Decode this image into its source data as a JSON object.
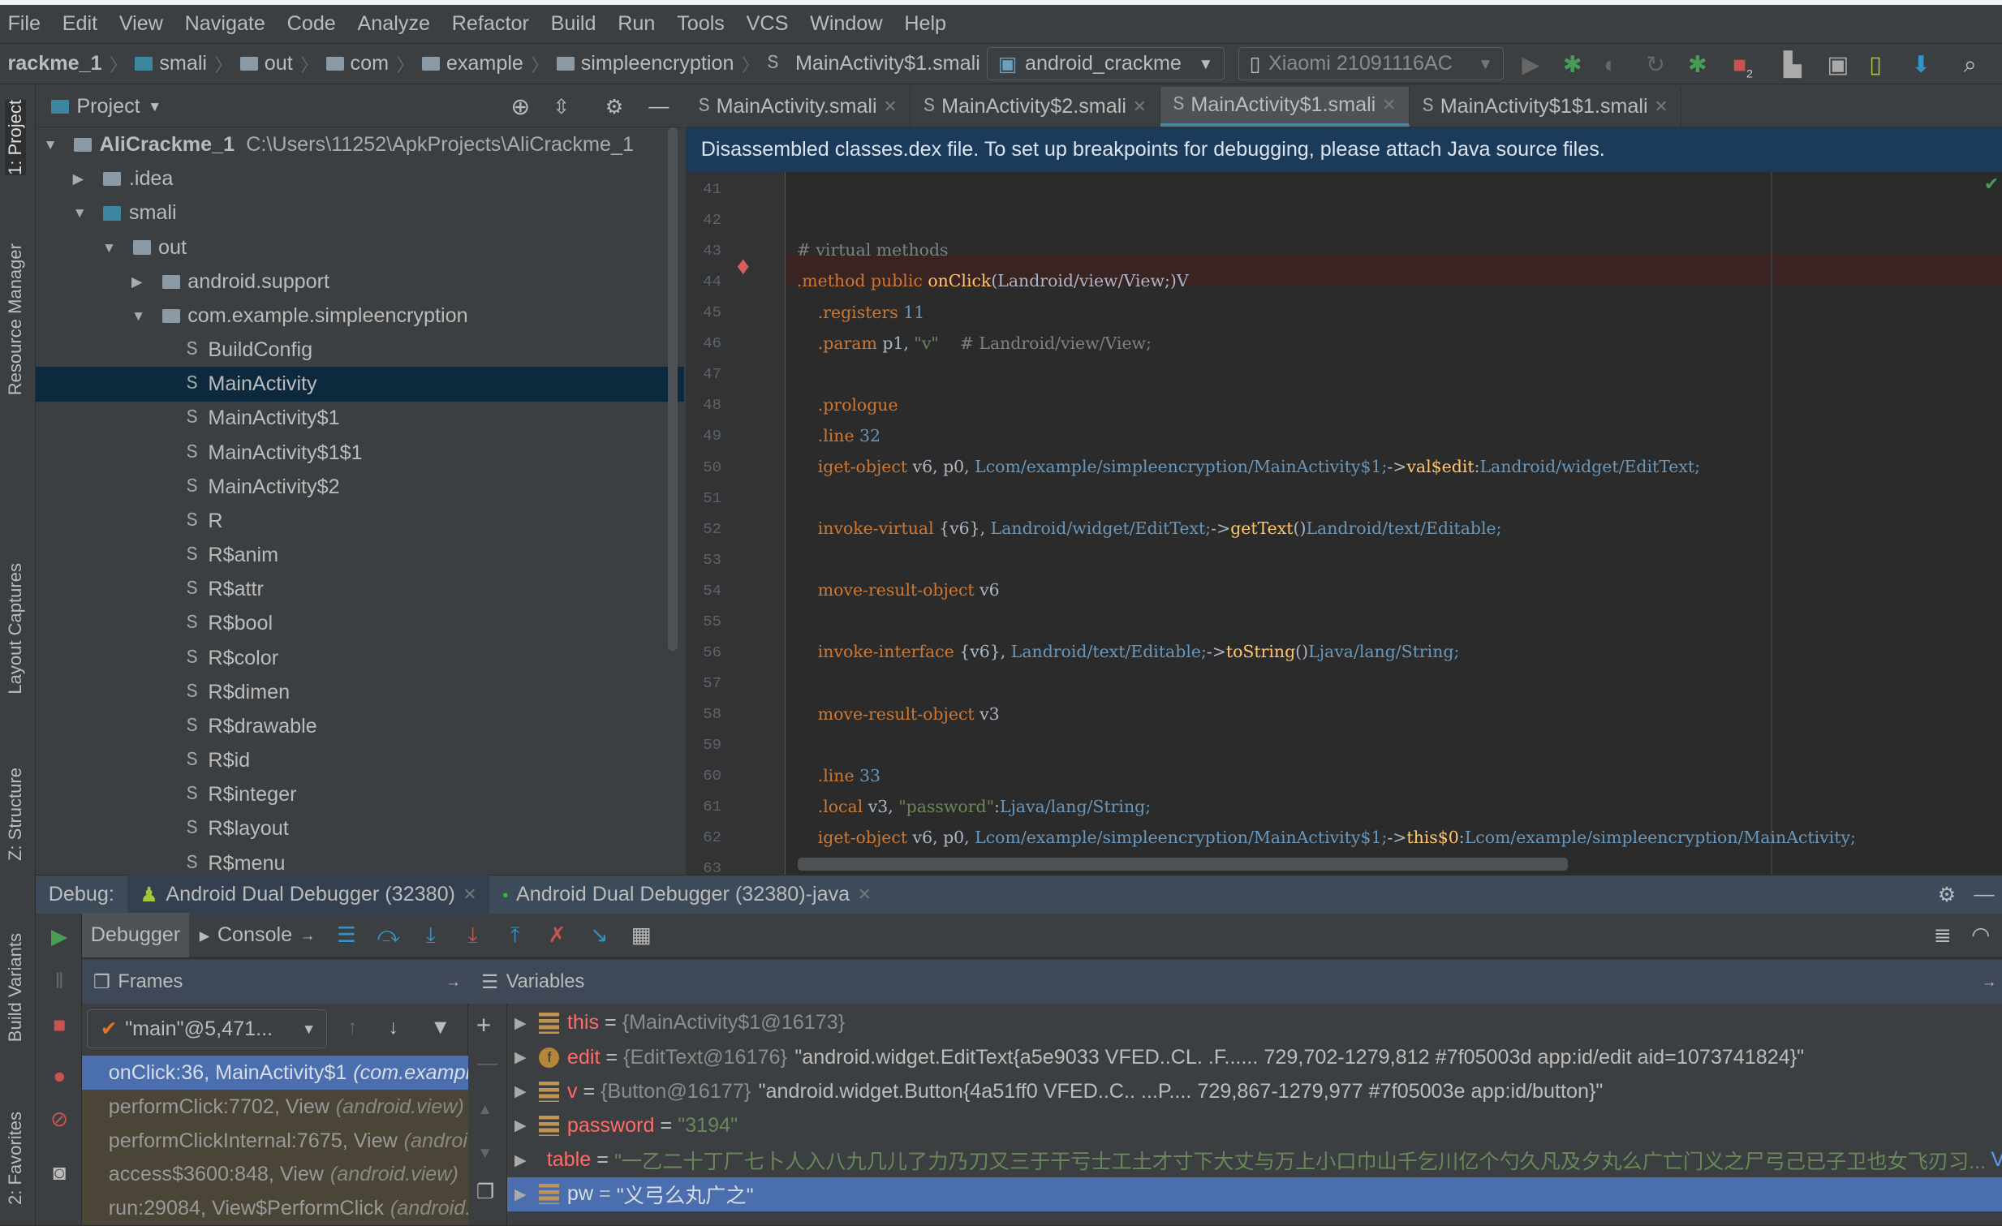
{
  "menu": [
    "File",
    "Edit",
    "View",
    "Navigate",
    "Code",
    "Analyze",
    "Refactor",
    "Build",
    "Run",
    "Tools",
    "VCS",
    "Window",
    "Help"
  ],
  "breadcrumb": [
    "rackme_1",
    "smali",
    "out",
    "com",
    "example",
    "simpleencryption",
    "MainActivity$1.smali"
  ],
  "toolbar": {
    "run_config": "android_crackme",
    "device": "Xiaomi 21091116AC",
    "stop_badge": "2"
  },
  "left_strip": [
    "1: Project",
    "Resource Manager",
    "Layout Captures",
    "Z: Structure",
    "Build Variants",
    "2: Favorites"
  ],
  "project": {
    "title": "Project",
    "tree": [
      {
        "label": "AliCrackme_1",
        "path": "C:\\Users\\11252\\ApkProjects\\AliCrackme_1",
        "depth": 0,
        "expanded": true,
        "kind": "module"
      },
      {
        "label": ".idea",
        "depth": 1,
        "expanded": false,
        "kind": "folder"
      },
      {
        "label": "smali",
        "depth": 1,
        "expanded": true,
        "kind": "folder"
      },
      {
        "label": "out",
        "depth": 2,
        "expanded": true,
        "kind": "folder"
      },
      {
        "label": "android.support",
        "depth": 3,
        "expanded": false,
        "kind": "folder"
      },
      {
        "label": "com.example.simpleencryption",
        "depth": 3,
        "expanded": true,
        "kind": "folder"
      },
      {
        "label": "BuildConfig",
        "depth": 4,
        "kind": "smali"
      },
      {
        "label": "MainActivity",
        "depth": 4,
        "kind": "smali",
        "selected": true
      },
      {
        "label": "MainActivity$1",
        "depth": 4,
        "kind": "smali"
      },
      {
        "label": "MainActivity$1$1",
        "depth": 4,
        "kind": "smali"
      },
      {
        "label": "MainActivity$2",
        "depth": 4,
        "kind": "smali"
      },
      {
        "label": "R",
        "depth": 4,
        "kind": "smali"
      },
      {
        "label": "R$anim",
        "depth": 4,
        "kind": "smali"
      },
      {
        "label": "R$attr",
        "depth": 4,
        "kind": "smali"
      },
      {
        "label": "R$bool",
        "depth": 4,
        "kind": "smali"
      },
      {
        "label": "R$color",
        "depth": 4,
        "kind": "smali"
      },
      {
        "label": "R$dimen",
        "depth": 4,
        "kind": "smali"
      },
      {
        "label": "R$drawable",
        "depth": 4,
        "kind": "smali"
      },
      {
        "label": "R$id",
        "depth": 4,
        "kind": "smali"
      },
      {
        "label": "R$integer",
        "depth": 4,
        "kind": "smali"
      },
      {
        "label": "R$layout",
        "depth": 4,
        "kind": "smali"
      },
      {
        "label": "R$menu",
        "depth": 4,
        "kind": "smali"
      }
    ]
  },
  "editor": {
    "tabs": [
      {
        "label": "MainActivity.smali"
      },
      {
        "label": "MainActivity$2.smali"
      },
      {
        "label": "MainActivity$1.smali",
        "active": true
      },
      {
        "label": "MainActivity$1$1.smali"
      }
    ],
    "banner": "Disassembled classes.dex file. To set up breakpoints for debugging, please attach Java source files.",
    "first_line": 41,
    "breakpoint_line": 44,
    "lines": [
      [],
      [],
      [
        [
          "c",
          "# virtual methods"
        ]
      ],
      [
        [
          "k",
          ".method public "
        ],
        [
          "f",
          "onClick"
        ],
        [
          "",
          "(Landroid/view/View;)V"
        ]
      ],
      [
        [
          "k",
          "    .registers "
        ],
        [
          "t",
          "11"
        ]
      ],
      [
        [
          "k",
          "    .param "
        ],
        [
          "",
          "p1, "
        ],
        [
          "s",
          "\"v\""
        ],
        [
          "c",
          "    # Landroid/view/View;"
        ]
      ],
      [],
      [
        [
          "k",
          "    .prologue"
        ]
      ],
      [
        [
          "k",
          "    .line "
        ],
        [
          "t",
          "32"
        ]
      ],
      [
        [
          "k",
          "    iget-object "
        ],
        [
          "",
          "v6, p0, "
        ],
        [
          "t",
          "Lcom/example/simpleencryption/MainActivity$1;"
        ],
        [
          "",
          "->"
        ],
        [
          "f",
          "val$edit"
        ],
        [
          "",
          ":"
        ],
        [
          "t",
          "Landroid/widget/EditText;"
        ]
      ],
      [],
      [
        [
          "k",
          "    invoke-virtual "
        ],
        [
          "",
          "{v6}, "
        ],
        [
          "t",
          "Landroid/widget/EditText;"
        ],
        [
          "",
          "->"
        ],
        [
          "f",
          "getText"
        ],
        [
          "",
          "()"
        ],
        [
          "t",
          "Landroid/text/Editable;"
        ]
      ],
      [],
      [
        [
          "k",
          "    move-result-object "
        ],
        [
          "",
          "v6"
        ]
      ],
      [],
      [
        [
          "k",
          "    invoke-interface "
        ],
        [
          "",
          "{v6}, "
        ],
        [
          "t",
          "Landroid/text/Editable;"
        ],
        [
          "",
          "->"
        ],
        [
          "f",
          "toString"
        ],
        [
          "",
          "()"
        ],
        [
          "t",
          "Ljava/lang/String;"
        ]
      ],
      [],
      [
        [
          "k",
          "    move-result-object "
        ],
        [
          "",
          "v3"
        ]
      ],
      [],
      [
        [
          "k",
          "    .line "
        ],
        [
          "t",
          "33"
        ]
      ],
      [
        [
          "k",
          "    .local "
        ],
        [
          "",
          "v3, "
        ],
        [
          "s",
          "\"password\""
        ],
        [
          "",
          ":"
        ],
        [
          "t",
          "Ljava/lang/String;"
        ]
      ],
      [
        [
          "k",
          "    iget-object "
        ],
        [
          "",
          "v6, p0, "
        ],
        [
          "t",
          "Lcom/example/simpleencryption/MainActivity$1;"
        ],
        [
          "",
          "->"
        ],
        [
          "f",
          "this$0"
        ],
        [
          "",
          ":"
        ],
        [
          "t",
          "Lcom/example/simpleencryption/MainActivity;"
        ]
      ],
      []
    ]
  },
  "debug": {
    "label": "Debug:",
    "sessions": [
      {
        "label": "Android Dual Debugger (32380)",
        "active": true
      },
      {
        "label": "Android Dual Debugger (32380)-java"
      }
    ],
    "tabs": {
      "debugger": "Debugger",
      "console": "Console"
    },
    "frames_title": "Frames",
    "variables_title": "Variables",
    "thread": "\"main\"@5,471...",
    "frames": [
      {
        "method": "onClick:36, MainActivity$1",
        "pkg": "(com.example.simpleencryption)",
        "selected": true
      },
      {
        "method": "performClick:7702, View",
        "pkg": "(android.view)"
      },
      {
        "method": "performClickInternal:7675, View",
        "pkg": "(android.view)"
      },
      {
        "method": "access$3600:848, View",
        "pkg": "(android.view)"
      },
      {
        "method": "run:29084, View$PerformClick",
        "pkg": "(android.view)"
      }
    ],
    "variables": [
      {
        "name": "this",
        "type": "{MainActivity$1@16173}",
        "value": "",
        "icon": "field"
      },
      {
        "name": "edit",
        "type": "{EditText@16176}",
        "value": "\"android.widget.EditText{a5e9033 VFED..CL. .F...... 729,702-1279,812 #7f05003d app:id/edit aid=1073741824}\"",
        "icon": "final-field"
      },
      {
        "name": "v",
        "type": "{Button@16177}",
        "value": "\"android.widget.Button{4a51ff0 VFED..C.. ...P.... 729,867-1279,977 #7f05003e app:id/button}\"",
        "icon": "field"
      },
      {
        "name": "password",
        "type": "",
        "str": "\"3194\"",
        "icon": "field"
      },
      {
        "name": "table",
        "type": "",
        "str": "\"一乙二十丁厂七卜人入八九几儿了力乃刀又三于干亏士工土才寸下大丈与万上小口巾山千乞川亿个勺久凡及夕丸么广亡门义之尸弓己已子卫也女飞刃习...",
        "link": "View",
        "icon": "field"
      },
      {
        "name": "pw",
        "type": "",
        "str": "\"义弓么丸广之\"",
        "icon": "field",
        "selected": true
      }
    ]
  },
  "colors": {
    "accent": "#4b6eaf",
    "banner": "#1c3b5b",
    "keyword": "#cc7832",
    "string": "#6a8759",
    "breakpoint": "#db5c5c"
  }
}
